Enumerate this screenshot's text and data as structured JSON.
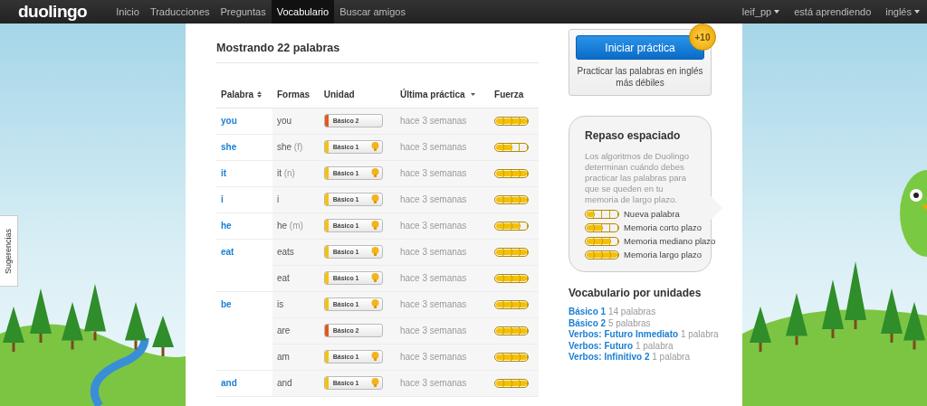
{
  "nav": {
    "logo": "duolingo",
    "links": [
      {
        "label": "Inicio",
        "selected": false
      },
      {
        "label": "Traducciones",
        "selected": false
      },
      {
        "label": "Preguntas",
        "selected": false
      },
      {
        "label": "Vocabulario",
        "selected": true
      },
      {
        "label": "Buscar amigos",
        "selected": false
      }
    ],
    "user": "leif_pp",
    "learning": "está aprendiendo",
    "language": "inglés"
  },
  "side_tab": "Sugerencias",
  "heading": "Mostrando 22 palabras",
  "table": {
    "columns": [
      {
        "label": "Palabra",
        "sorted": false
      },
      {
        "label": "Formas"
      },
      {
        "label": "Unidad"
      },
      {
        "label": "Última práctica",
        "sorted": true
      },
      {
        "label": "Fuerza"
      }
    ],
    "words": [
      {
        "word": "you",
        "forms": [
          {
            "form": "you",
            "unit": "Básico 2",
            "color": "#e05a1e",
            "gold": false,
            "last": "hace 3 semanas",
            "level": 1
          }
        ]
      },
      {
        "word": "she",
        "forms": [
          {
            "form": "she",
            "hint": "(f)",
            "unit": "Básico 1",
            "color": "#f5c211",
            "gold": true,
            "last": "hace 3 semanas",
            "level": 0.5
          }
        ]
      },
      {
        "word": "it",
        "forms": [
          {
            "form": "it",
            "hint": "(n)",
            "unit": "Básico 1",
            "color": "#f5c211",
            "gold": true,
            "last": "hace 3 semanas",
            "level": 1
          }
        ]
      },
      {
        "word": "i",
        "forms": [
          {
            "form": "i",
            "unit": "Básico 1",
            "color": "#f5c211",
            "gold": true,
            "last": "hace 3 semanas",
            "level": 1
          }
        ]
      },
      {
        "word": "he",
        "forms": [
          {
            "form": "he",
            "hint": "(m)",
            "unit": "Básico 1",
            "color": "#f5c211",
            "gold": true,
            "last": "hace 3 semanas",
            "level": 0.75
          }
        ]
      },
      {
        "word": "eat",
        "forms": [
          {
            "form": "eats",
            "unit": "Básico 1",
            "color": "#f5c211",
            "gold": true,
            "last": "hace 3 semanas",
            "level": 1
          },
          {
            "form": "eat",
            "unit": "Básico 1",
            "color": "#f5c211",
            "gold": true,
            "last": "hace 3 semanas",
            "level": 1
          }
        ]
      },
      {
        "word": "be",
        "forms": [
          {
            "form": "is",
            "unit": "Básico 1",
            "color": "#f5c211",
            "gold": true,
            "last": "hace 3 semanas",
            "level": 1
          },
          {
            "form": "are",
            "unit": "Básico 2",
            "color": "#e05a1e",
            "gold": false,
            "last": "hace 3 semanas",
            "level": 1
          },
          {
            "form": "am",
            "unit": "Básico 1",
            "color": "#f5c211",
            "gold": true,
            "last": "hace 3 semanas",
            "level": 1
          }
        ]
      },
      {
        "word": "and",
        "forms": [
          {
            "form": "and",
            "unit": "Básico 1",
            "color": "#f5c211",
            "gold": true,
            "last": "hace 3 semanas",
            "level": 1
          }
        ]
      }
    ]
  },
  "practice": {
    "button": "Iniciar práctica",
    "bonus": "+10",
    "caption": "Practicar las palabras en inglés más débiles"
  },
  "review": {
    "title": "Repaso espaciado",
    "text": "Los algoritmos de Duolingo determinan cuándo debes practicar las palabras para que se queden en tu memoria de largo plazo.",
    "legend": [
      {
        "label": "Nueva palabra",
        "level": 0.25
      },
      {
        "label": "Memoria corto plazo",
        "level": 0.5
      },
      {
        "label": "Memoria mediano plazo",
        "level": 0.75
      },
      {
        "label": "Memoria largo plazo",
        "level": 1
      }
    ]
  },
  "units": {
    "title": "Vocabulario por unidades",
    "items": [
      {
        "name": "Básico 1",
        "count": "14 palabras"
      },
      {
        "name": "Básico 2",
        "count": "5 palabras"
      },
      {
        "name": "Verbos: Futuro Inmediato",
        "count": "1 palabra"
      },
      {
        "name": "Verbos: Futuro",
        "count": "1 palabra"
      },
      {
        "name": "Verbos: Infinitivo 2",
        "count": "1 palabra"
      }
    ]
  }
}
